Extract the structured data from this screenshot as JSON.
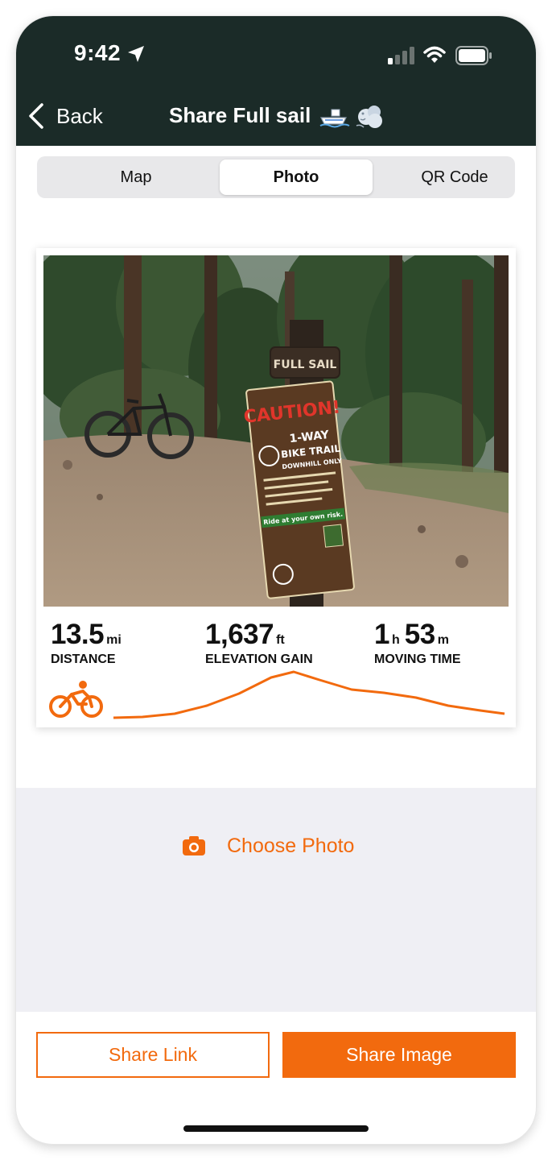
{
  "status_bar": {
    "time": "9:42"
  },
  "nav": {
    "back_label": "Back",
    "title": "Share Full sail"
  },
  "tabs": [
    {
      "label": "Map",
      "selected": false
    },
    {
      "label": "Photo",
      "selected": true
    },
    {
      "label": "QR Code",
      "selected": false
    }
  ],
  "card": {
    "stats": {
      "distance": {
        "value": "13.5",
        "unit": "mi",
        "label": "DISTANCE"
      },
      "elevation": {
        "value": "1,637",
        "unit": "ft",
        "label": "ELEVATION GAIN"
      },
      "moving_time": {
        "hours": "1",
        "hours_unit": "h",
        "minutes": "53",
        "minutes_unit": "m",
        "label": "MOVING TIME"
      }
    },
    "photo_sign": {
      "name_plate": "FULL SAIL",
      "caution": "CAUTION!",
      "line1": "1-WAY",
      "line2": "BIKE TRAIL",
      "line3": "DOWNHILL ONLY",
      "banner": "Ride at your own risk."
    },
    "activity_icon": "cycling-icon"
  },
  "choose_photo": {
    "label": "Choose Photo",
    "icon": "camera-icon"
  },
  "buttons": {
    "share_link": "Share Link",
    "share_image": "Share Image"
  },
  "colors": {
    "accent": "#f26a0e",
    "header_bg": "#1b2b28",
    "segment_bg": "#e8e8ea",
    "gray_area": "#efeff4"
  }
}
